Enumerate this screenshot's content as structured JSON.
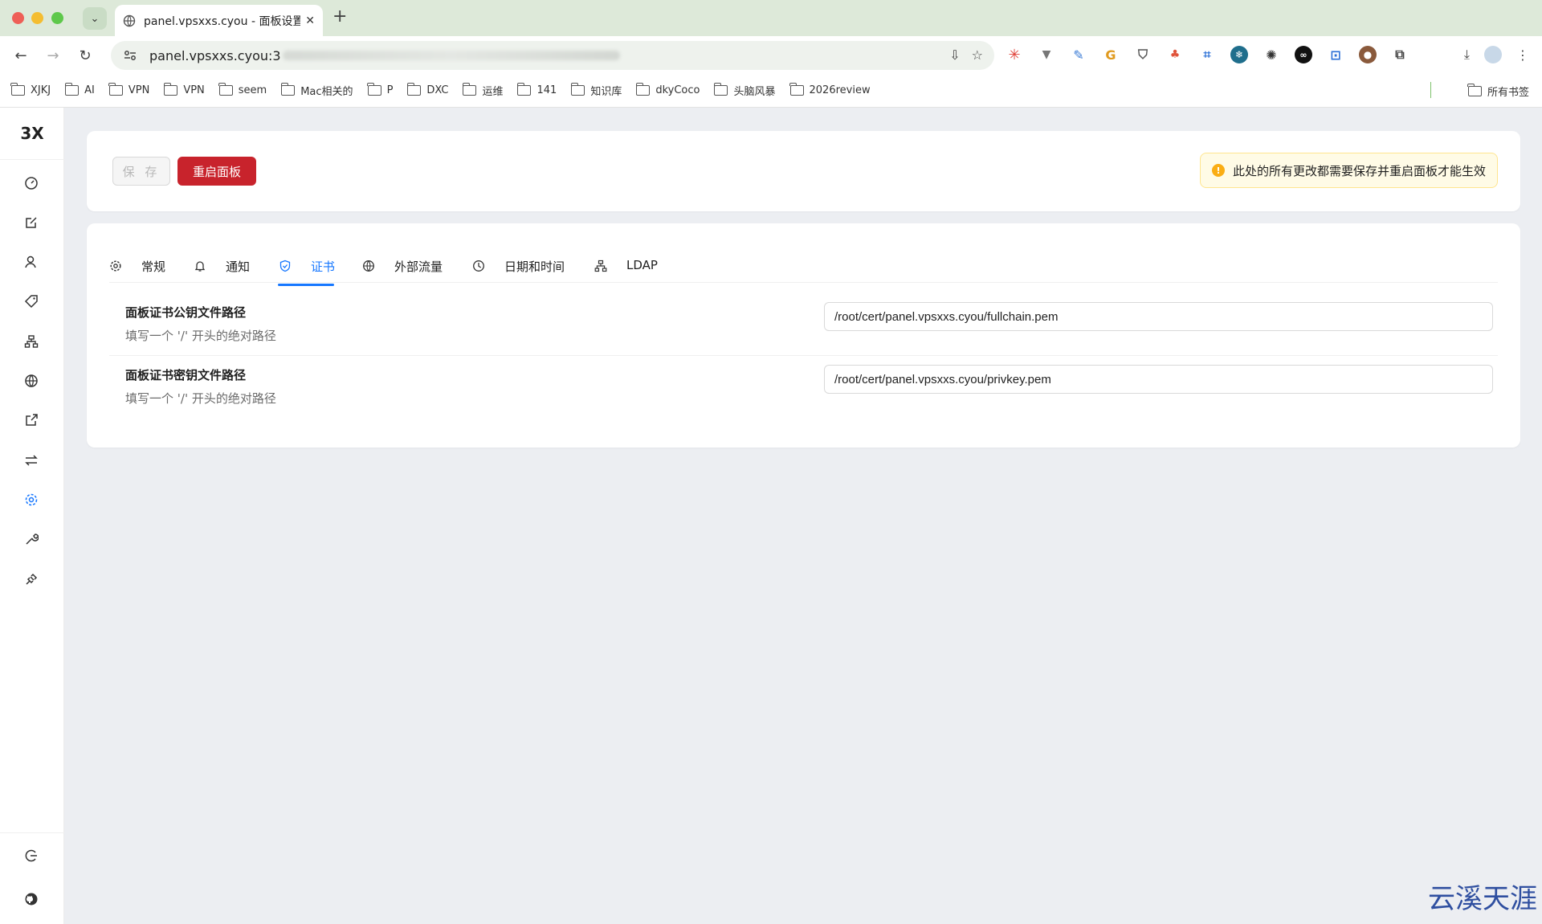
{
  "browser": {
    "tab_title": "panel.vpsxxs.cyou - 面板设置",
    "url_visible": "panel.vpsxxs.cyou:3",
    "bookmarks": [
      "XJKJ",
      "AI",
      "VPN",
      "VPN",
      "seem",
      "Mac相关的",
      "P",
      "DXC",
      "运维",
      "141",
      "知识库",
      "dkyCoco",
      "头脑风暴",
      "2026review"
    ],
    "all_bookmarks": "所有书签"
  },
  "app": {
    "brand": "3X",
    "accent_color": "#1677ff",
    "danger_color": "#c8232c",
    "sidebar_icons": [
      "dashboard-icon",
      "inbounds-icon",
      "clients-icon",
      "tag-icon",
      "nodes-icon",
      "globe-icon",
      "export-icon",
      "swap-icon",
      "settings-icon",
      "tools-icon",
      "xray-icon"
    ],
    "sidebar_bottom_icons": [
      "logout-icon",
      "github-icon"
    ]
  },
  "actions": {
    "save_label": "保 存",
    "restart_label": "重启面板",
    "alert_text": "此处的所有更改都需要保存并重启面板才能生效"
  },
  "tabs": [
    {
      "label": "常规",
      "icon": "gear-icon"
    },
    {
      "label": "通知",
      "icon": "bell-icon"
    },
    {
      "label": "证书",
      "icon": "shield-icon",
      "active": true
    },
    {
      "label": "外部流量",
      "icon": "globe-icon"
    },
    {
      "label": "日期和时间",
      "icon": "clock-icon"
    },
    {
      "label": "LDAP",
      "icon": "cluster-icon"
    }
  ],
  "settings": [
    {
      "title": "面板证书公钥文件路径",
      "desc": "填写一个 '/' 开头的绝对路径",
      "value": "/root/cert/panel.vpsxxs.cyou/fullchain.pem"
    },
    {
      "title": "面板证书密钥文件路径",
      "desc": "填写一个 '/' 开头的绝对路径",
      "value": "/root/cert/panel.vpsxxs.cyou/privkey.pem"
    }
  ],
  "watermark": "云溪天涯"
}
